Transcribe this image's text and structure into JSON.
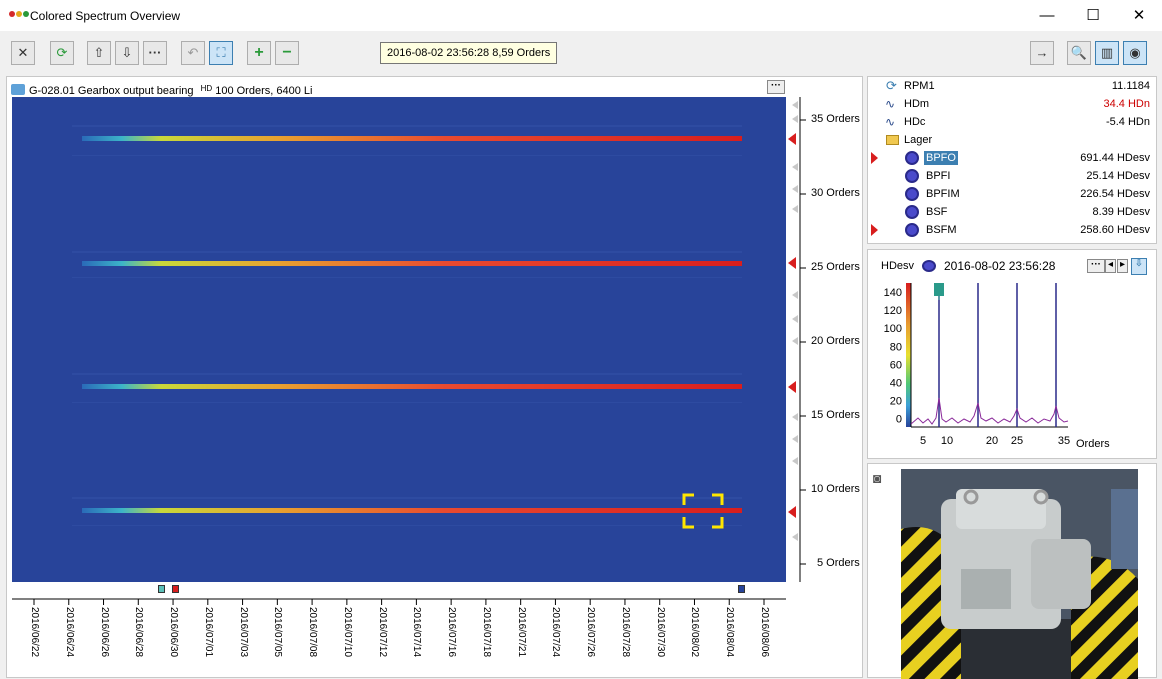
{
  "window": {
    "title": "Colored Spectrum Overview",
    "controls": {
      "minimize": "—",
      "maximize": "☐",
      "close": "✕"
    }
  },
  "toolbar": {
    "buttons": [
      "close",
      "refresh",
      "arrow-up",
      "arrow-down",
      "more",
      "undo",
      "fit",
      "zoom-in",
      "zoom-out"
    ],
    "tooltip_text": "2016-08-02 23:56:28   8,59 Orders",
    "right_buttons": [
      "next",
      "search",
      "export",
      "snapshot"
    ]
  },
  "heatmap_panel": {
    "header": "G-028.01 Gearbox output bearing",
    "header_suffix": "100 Orders, 6400 Li",
    "hd_badge": "HD",
    "more_label": "···",
    "y_ticks": [
      "35 Orders",
      "30 Orders",
      "25 Orders",
      "20 Orders",
      "15 Orders",
      "10 Orders",
      "5 Orders"
    ],
    "x_dates": [
      "2016/06/22",
      "2016/06/24",
      "2016/06/26",
      "2016/06/28",
      "2016/06/30",
      "2016/07/01",
      "2016/07/03",
      "2016/07/05",
      "2016/07/08",
      "2016/07/10",
      "2016/07/12",
      "2016/07/14",
      "2016/07/16",
      "2016/07/18",
      "2016/07/21",
      "2016/07/24",
      "2016/07/26",
      "2016/07/28",
      "2016/07/30",
      "2016/08/02",
      "2016/08/04",
      "2016/08/06"
    ]
  },
  "tree": {
    "rows": [
      {
        "name": "RPM1",
        "value": "11.1184",
        "icon": "rpm-icon",
        "value_color": "#000000"
      },
      {
        "name": "HDm",
        "value": "34.4 HDn",
        "icon": "wave-icon",
        "value_color": "#cc0000"
      },
      {
        "name": "HDc",
        "value": "-5.4 HDn",
        "icon": "wave-icon",
        "value_color": "#000000"
      },
      {
        "name": "Lager",
        "value": "",
        "icon": "folder-icon",
        "value_color": "#000000"
      },
      {
        "name": "BPFO",
        "value": "691.44 HDesv",
        "icon": "bearing-icon",
        "value_color": "#000000",
        "selected": true
      },
      {
        "name": "BPFI",
        "value": "25.14 HDesv",
        "icon": "bearing-icon",
        "value_color": "#000000"
      },
      {
        "name": "BPFIM",
        "value": "226.54 HDesv",
        "icon": "bearing-icon",
        "value_color": "#000000"
      },
      {
        "name": "BSF",
        "value": "8.39 HDesv",
        "icon": "bearing-icon",
        "value_color": "#000000"
      },
      {
        "name": "BSFM",
        "value": "258.60 HDesv",
        "icon": "bearing-icon",
        "value_color": "#000000"
      }
    ]
  },
  "spectrum": {
    "unit": "HDesv",
    "timestamp": "2016-08-02 23:56:28",
    "y_ticks": [
      "140",
      "120",
      "100",
      "80",
      "60",
      "40",
      "20",
      "0"
    ],
    "x_ticks": [
      "5",
      "10",
      "20",
      "25",
      "35"
    ],
    "x_unit": "Orders",
    "more_label": "···"
  },
  "colors": {
    "accent": "#3c7fb1",
    "heatmap_bg": "#28449a",
    "alarm": "#d81e1e"
  }
}
